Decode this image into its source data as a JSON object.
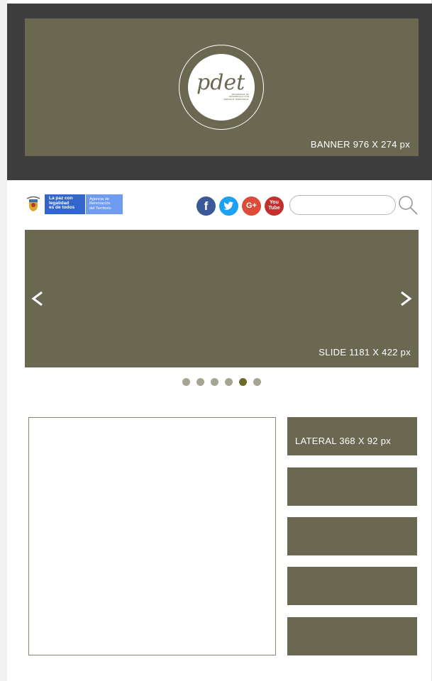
{
  "banner": {
    "size_label": "BANNER  976 X 274 px",
    "logo_text": "pdet",
    "logo_tagline": "PROGRAMAS DE DESARROLLO CON ENFOQUE TERRITORIAL"
  },
  "gov_logo": {
    "line1": "La paz con",
    "line2": "legalidad",
    "line3": "es de todos",
    "agency1": "Agencia de",
    "agency2": "Renovación",
    "agency3": "del Territorio"
  },
  "social": {
    "facebook_glyph": "f",
    "google_glyph": "G+",
    "youtube_line1": "You",
    "youtube_line2": "Tube"
  },
  "search": {
    "value": "",
    "placeholder": ""
  },
  "slider": {
    "size_label": "SLIDE  1181 X 422 px",
    "dot_count": 6,
    "active_dot": 5
  },
  "lateral": {
    "items": [
      {
        "label": "LATERAL  368 X 92 px"
      },
      {
        "label": ""
      },
      {
        "label": ""
      },
      {
        "label": ""
      },
      {
        "label": ""
      }
    ]
  },
  "colors": {
    "banner": "#6b6851",
    "header_band": "#3e3e3e",
    "dot": "#a6a591",
    "dot_active": "#6b6a2a"
  }
}
